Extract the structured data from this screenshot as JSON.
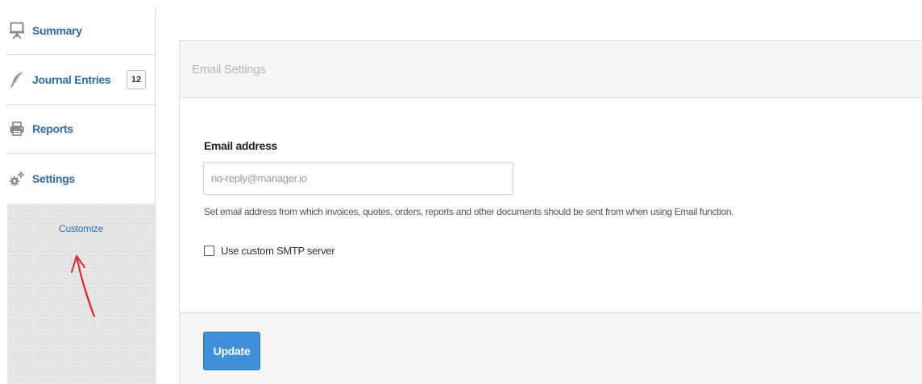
{
  "sidebar": {
    "items": [
      {
        "label": "Summary",
        "icon": "presentation-board-icon"
      },
      {
        "label": "Journal Entries",
        "icon": "quill-pen-icon",
        "badge": "12"
      },
      {
        "label": "Reports",
        "icon": "printer-icon"
      },
      {
        "label": "Settings",
        "icon": "gears-icon"
      }
    ],
    "customize_label": "Customize"
  },
  "panel": {
    "title": "Email Settings",
    "email_field": {
      "label": "Email address",
      "value": "",
      "placeholder": "no-reply@manager.io"
    },
    "help_text": "Set email address from which invoices, quotes, orders, reports and other documents should be sent from when using Email function.",
    "smtp_checkbox": {
      "label": "Use custom SMTP server",
      "checked": false
    },
    "update_label": "Update"
  },
  "colors": {
    "link": "#2a6db5",
    "primary_button": "#3f8fd8",
    "annotation_arrow": "#e8252a"
  }
}
